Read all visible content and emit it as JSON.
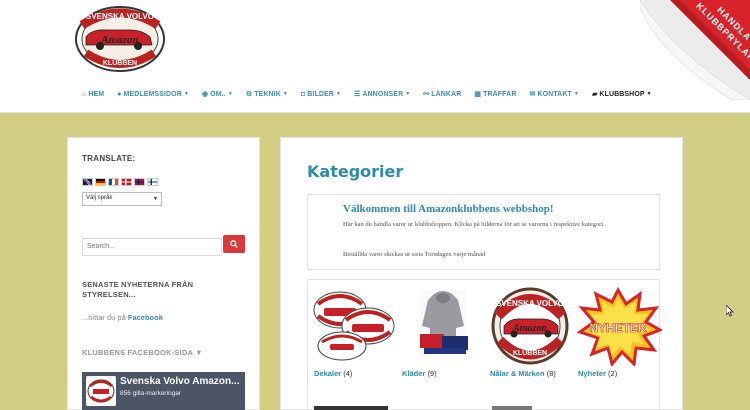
{
  "header": {
    "logo": {
      "top_text": "SVENSKA VOLVO",
      "script_text": "Amazon",
      "bottom_text": "KLUBBEN"
    },
    "nav": [
      {
        "icon": "home-icon",
        "glyph": "⌂",
        "label": "HEM",
        "dropdown": false
      },
      {
        "icon": "user-icon",
        "glyph": "👤",
        "label": "MEDLEMSSIDOR",
        "dropdown": true
      },
      {
        "icon": "eye-icon",
        "glyph": "◉",
        "label": "OM..",
        "dropdown": true
      },
      {
        "icon": "cogs-icon",
        "glyph": "⚙",
        "label": "TEKNIK",
        "dropdown": true
      },
      {
        "icon": "camera-icon",
        "glyph": "◘",
        "label": "BILDER",
        "dropdown": true
      },
      {
        "icon": "list-icon",
        "glyph": "☰",
        "label": "ANNONSER",
        "dropdown": true
      },
      {
        "icon": "link-icon",
        "glyph": "⚯",
        "label": "LÄNKAR",
        "dropdown": false
      },
      {
        "icon": "table-icon",
        "glyph": "▦",
        "label": "TRÄFFAR",
        "dropdown": false
      },
      {
        "icon": "envelope-icon",
        "glyph": "✉",
        "label": "KONTAKT",
        "dropdown": true
      },
      {
        "icon": "cart-icon",
        "glyph": "🛒",
        "label": "KLUBBSHOP",
        "dropdown": true
      }
    ],
    "ribbon": {
      "line1": "HANDLA",
      "line2": "KLUBBPRYLAR",
      "color": "#d8232a"
    }
  },
  "sidebar": {
    "translate_title": "TRANSLATE:",
    "language_select": "Välj språk",
    "search_placeholder": "Search...",
    "news_title": "SENASTE NYHETERNA FRÅN STYRELSEN...",
    "news_text_prefix": "...hittar du på",
    "news_text_link": "Facebook",
    "fb_title": "KLUBBENS FACEBOOK-SIDA ▼",
    "fb_widget": {
      "name": "Svenska Volvo Amazon...",
      "likes": "856 gilla-markeringar"
    }
  },
  "main": {
    "title": "Kategorier",
    "intro": {
      "heading": "Välkommen till Amazonklubbens webbshop!",
      "text": "Här kan du handla varor ur klubbshoppen. Klicka på bilderna för att se varorna i respektive kategori .",
      "note": "Beställda varor skickas ut sista Torsdagen varje månad"
    },
    "categories": [
      {
        "label": "Dekaler",
        "count": "(4)"
      },
      {
        "label": "Kläder",
        "count": "(9)"
      },
      {
        "label": "Nålar & Märken",
        "count": "(8)"
      },
      {
        "label": "Nyheter",
        "count": "(2)",
        "badge": "NYHETER"
      }
    ]
  },
  "colors": {
    "accent": "#2e8bab",
    "background": "#d2cf84",
    "search_button": "#d9393b"
  }
}
